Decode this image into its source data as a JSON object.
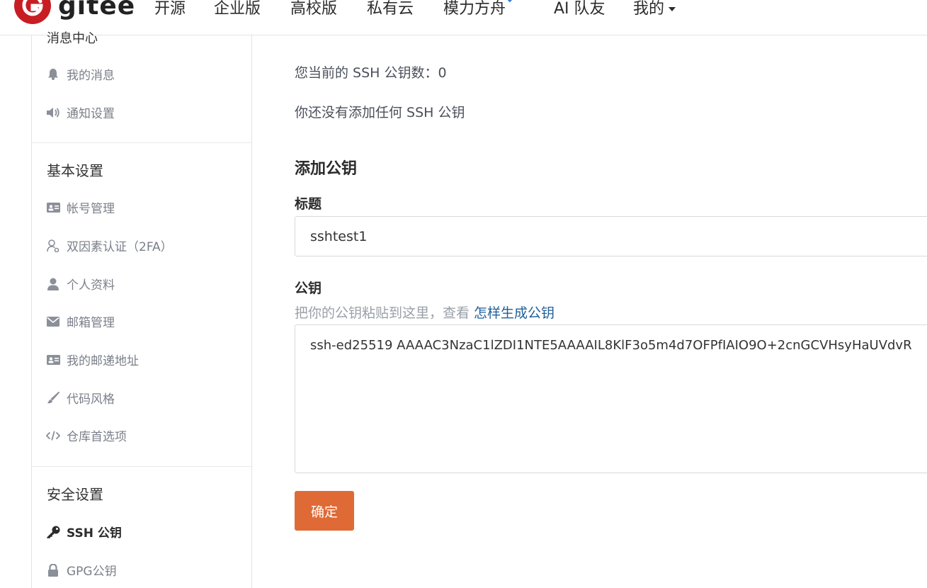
{
  "topnav": {
    "logo_text": "gitee",
    "items": [
      {
        "label": "开源"
      },
      {
        "label": "企业版"
      },
      {
        "label": "高校版"
      },
      {
        "label": "私有云"
      },
      {
        "label": "模力方舟"
      },
      {
        "label": "AI 队友"
      },
      {
        "label": "我的"
      }
    ]
  },
  "sidebar": {
    "cut_heading": "消息中心",
    "message_items": [
      {
        "label": "我的消息",
        "icon": "bell-icon"
      },
      {
        "label": "通知设置",
        "icon": "speaker-icon"
      }
    ],
    "basic_title": "基本设置",
    "basic_items": [
      {
        "label": "帐号管理",
        "icon": "id-card-icon"
      },
      {
        "label": "双因素认证（2FA）",
        "icon": "user-outline-icon"
      },
      {
        "label": "个人资料",
        "icon": "user-icon"
      },
      {
        "label": "邮箱管理",
        "icon": "envelope-icon"
      },
      {
        "label": "我的邮递地址",
        "icon": "address-card-icon"
      },
      {
        "label": "代码风格",
        "icon": "brush-icon"
      },
      {
        "label": "仓库首选项",
        "icon": "code-icon"
      }
    ],
    "security_title": "安全设置",
    "security_items": [
      {
        "label": "SSH 公钥",
        "icon": "key-icon"
      },
      {
        "label": "GPG公钥",
        "icon": "lock-icon"
      }
    ]
  },
  "main": {
    "ssh_count_label": "您当前的 SSH 公钥数：",
    "ssh_count": "0",
    "no_keys_text": "你还没有添加任何 SSH 公钥",
    "add_title": "添加公钥",
    "title_label": "标题",
    "title_value": "sshtest1",
    "key_label": "公钥",
    "key_hint": "把你的公钥粘贴到这里，查看 ",
    "key_hint_link": "怎样生成公钥",
    "key_value": "ssh-ed25519 AAAAC3NzaC1lZDI1NTE5AAAAIL8KlF3o5m4d7OFPfIAIO9O+2cnGCVHsyHaUVdvR",
    "submit_label": "确定"
  },
  "colors": {
    "brand": "#c71d23",
    "button": "#e06a36",
    "link": "#1f5f9a"
  }
}
